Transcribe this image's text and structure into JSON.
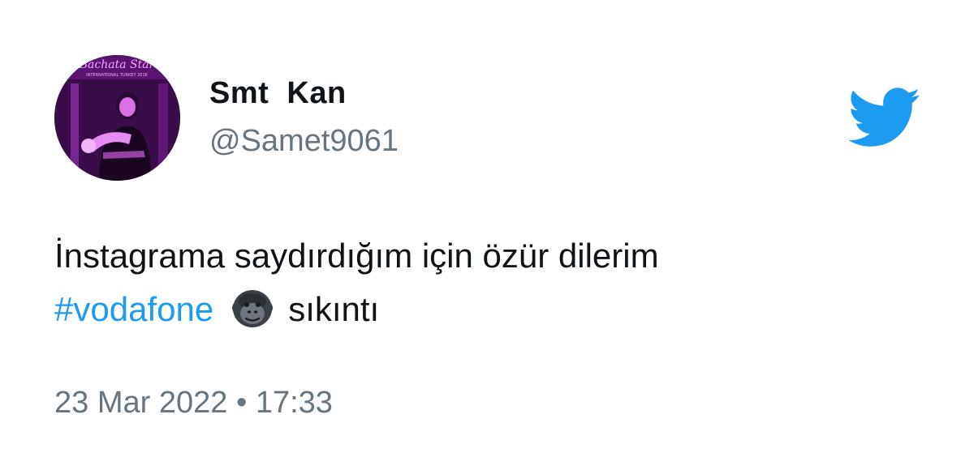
{
  "author": {
    "display_name": "Smt  Kan",
    "handle": "@Samet9061",
    "avatar_text": "Bachata Star",
    "avatar_subtext": "INTERNATIONAL TURKEY 2016"
  },
  "tweet": {
    "line1": "İnstagrama saydırdığım için özür dilerim",
    "hashtag": "#vodafone",
    "emoji_icon": "gorilla-icon",
    "after_emoji": "sıkıntı"
  },
  "meta": {
    "date": "23 Mar 2022",
    "separator": "•",
    "time": "17:33"
  },
  "brand": {
    "logo_icon": "twitter-bird-icon",
    "accent_color": "#1d9bf0",
    "text_color": "#0f1419",
    "muted_color": "#66757f"
  }
}
